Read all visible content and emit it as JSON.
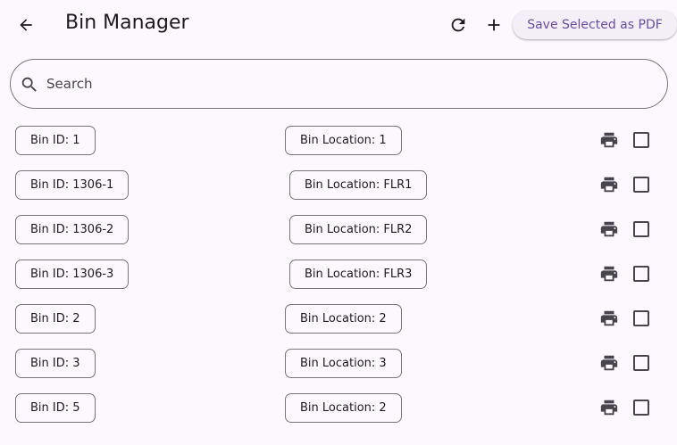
{
  "appbar": {
    "title": "Bin Manager",
    "back_icon": "arrow-back-icon",
    "refresh_icon": "refresh-icon",
    "add_icon": "add-icon",
    "pdf_button_label": "Save Selected as PDF",
    "accent_color": "#6750a4"
  },
  "search": {
    "placeholder": "Search",
    "value": "",
    "icon": "search-icon"
  },
  "bins": [
    {
      "id_label": "Bin ID: 1",
      "location_label": "Bin Location: 1",
      "checked": false
    },
    {
      "id_label": "Bin ID: 1306-1",
      "location_label": "Bin Location: FLR1",
      "checked": false
    },
    {
      "id_label": "Bin ID: 1306-2",
      "location_label": "Bin Location: FLR2",
      "checked": false
    },
    {
      "id_label": "Bin ID: 1306-3",
      "location_label": "Bin Location: FLR3",
      "checked": false
    },
    {
      "id_label": "Bin ID: 2",
      "location_label": "Bin Location: 2",
      "checked": false
    },
    {
      "id_label": "Bin ID: 3",
      "location_label": "Bin Location: 3",
      "checked": false
    },
    {
      "id_label": "Bin ID: 5",
      "location_label": "Bin Location: 2",
      "checked": false
    }
  ]
}
